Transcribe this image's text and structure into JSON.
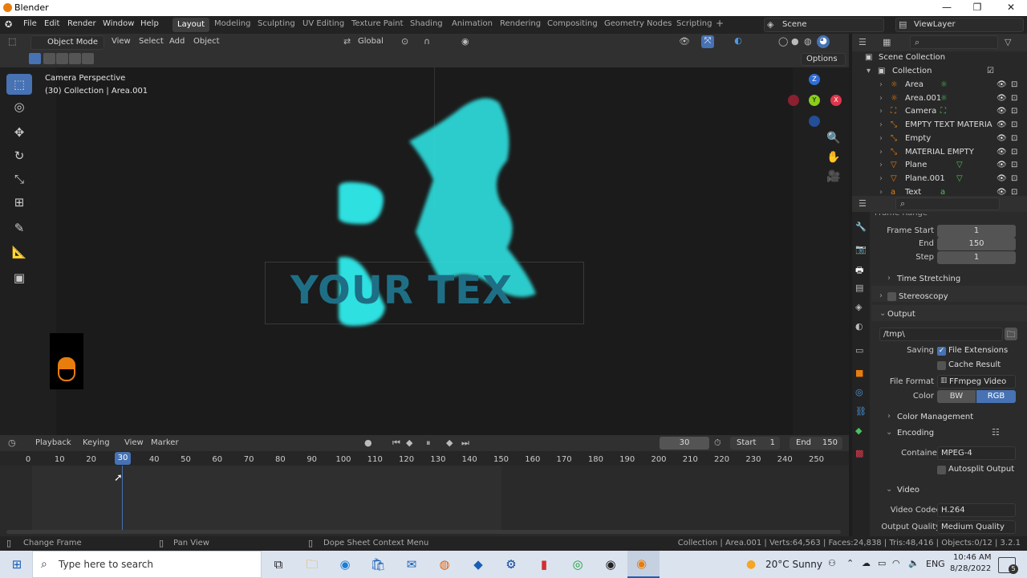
{
  "window": {
    "title": "Blender",
    "minimize": "—",
    "maximize": "❐",
    "close": "✕"
  },
  "menu": {
    "items": [
      "File",
      "Edit",
      "Render",
      "Window",
      "Help"
    ]
  },
  "workspaces": {
    "items": [
      "Layout",
      "Modeling",
      "Sculpting",
      "UV Editing",
      "Texture Paint",
      "Shading",
      "Animation",
      "Rendering",
      "Compositing",
      "Geometry Nodes",
      "Scripting"
    ],
    "active": "Layout",
    "add": "+"
  },
  "scene": {
    "name": "Scene",
    "view_layer": "ViewLayer"
  },
  "viewport_header": {
    "mode": "Object Mode",
    "view": "View",
    "select": "Select",
    "add": "Add",
    "object": "Object",
    "orientation": "Global",
    "options": "Options"
  },
  "viewport": {
    "camera_label": "Camera Perspective",
    "collection_label": "(30) Collection | Area.001",
    "text_object": "YOUR TEX"
  },
  "outliner": {
    "root": "Scene Collection",
    "collection": "Collection",
    "items": [
      {
        "name": "Area",
        "icon": "light-icon"
      },
      {
        "name": "Area.001",
        "icon": "light-icon"
      },
      {
        "name": "Camera",
        "icon": "camera-icon"
      },
      {
        "name": "EMPTY TEXT MATERIA",
        "icon": "empty-icon"
      },
      {
        "name": "Empty",
        "icon": "empty-icon"
      },
      {
        "name": "MATERIAL EMPTY",
        "icon": "empty-icon"
      },
      {
        "name": "Plane",
        "icon": "mesh-icon"
      },
      {
        "name": "Plane.001",
        "icon": "mesh-icon"
      },
      {
        "name": "Text",
        "icon": "text-icon"
      }
    ]
  },
  "properties": {
    "cut_heading": "Frame Range",
    "frame_start_label": "Frame Start",
    "frame_start": "1",
    "end_label": "End",
    "end": "150",
    "step_label": "Step",
    "step": "1",
    "time_stretching": "Time Stretching",
    "stereoscopy": "Stereoscopy",
    "output": "Output",
    "output_path": "/tmp\\",
    "saving_label": "Saving",
    "file_extensions": "File Extensions",
    "cache_result": "Cache Result",
    "file_format_label": "File Format",
    "file_format": "FFmpeg Video",
    "color_label": "Color",
    "color_bw": "BW",
    "color_rgb": "RGB",
    "color_management": "Color Management",
    "encoding": "Encoding",
    "container_label": "Container",
    "container": "MPEG-4",
    "autosplit": "Autosplit Output",
    "video": "Video",
    "video_codec_label": "Video Codec",
    "video_codec": "H.264",
    "output_quality_label": "Output Quality",
    "output_quality": "Medium Quality"
  },
  "timeline": {
    "playback": "Playback",
    "keying": "Keying",
    "view": "View",
    "marker": "Marker",
    "current_frame": "30",
    "start_label": "Start",
    "start": "1",
    "end_label": "End",
    "end": "150",
    "ticks": [
      "0",
      "10",
      "20",
      "30",
      "40",
      "50",
      "60",
      "70",
      "80",
      "90",
      "100",
      "110",
      "120",
      "130",
      "140",
      "150",
      "160",
      "170",
      "180",
      "190",
      "200",
      "210",
      "220",
      "230",
      "240",
      "250"
    ],
    "playhead": "30"
  },
  "statusbar": {
    "change_frame": "Change Frame",
    "pan_view": "Pan View",
    "context_menu": "Dope Sheet Context Menu",
    "stats": "Collection | Area.001 | Verts:64,563 | Faces:24,838 | Tris:48,416 | Objects:0/12 | 3.2.1"
  },
  "taskbar": {
    "search_placeholder": "Type here to search",
    "weather": "20°C  Sunny",
    "lang": "ENG",
    "time": "10:46 AM",
    "date": "8/28/2022",
    "notifications": "5"
  },
  "colors": {
    "accent": "#4772b3",
    "orange": "#e87d0d",
    "particles": "#2de0e0",
    "text_object": "#1e6f86"
  }
}
